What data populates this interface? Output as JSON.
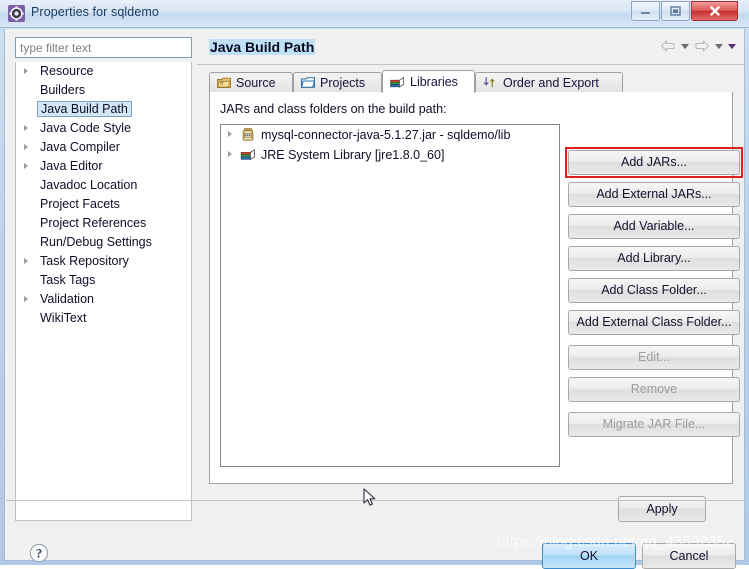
{
  "window": {
    "title": "Properties for sqldemo",
    "icon": "gear-icon",
    "controls": {
      "minimize": "—",
      "maximize": "□",
      "close": "✕"
    }
  },
  "sidebar": {
    "filter": {
      "value": "",
      "placeholder": "type filter text"
    },
    "items": [
      {
        "label": "Resource",
        "expandable": true,
        "selected": false
      },
      {
        "label": "Builders",
        "expandable": false,
        "selected": false
      },
      {
        "label": "Java Build Path",
        "expandable": false,
        "selected": true
      },
      {
        "label": "Java Code Style",
        "expandable": true,
        "selected": false
      },
      {
        "label": "Java Compiler",
        "expandable": true,
        "selected": false
      },
      {
        "label": "Java Editor",
        "expandable": true,
        "selected": false
      },
      {
        "label": "Javadoc Location",
        "expandable": false,
        "selected": false
      },
      {
        "label": "Project Facets",
        "expandable": false,
        "selected": false
      },
      {
        "label": "Project References",
        "expandable": false,
        "selected": false
      },
      {
        "label": "Run/Debug Settings",
        "expandable": false,
        "selected": false
      },
      {
        "label": "Task Repository",
        "expandable": true,
        "selected": false
      },
      {
        "label": "Task Tags",
        "expandable": false,
        "selected": false
      },
      {
        "label": "Validation",
        "expandable": true,
        "selected": false
      },
      {
        "label": "WikiText",
        "expandable": false,
        "selected": false
      }
    ]
  },
  "page": {
    "title": "Java Build Path",
    "nav": {
      "back_icon": "arrow-left-icon",
      "back_menu_icon": "chevron-down-icon",
      "forward_icon": "arrow-right-icon",
      "forward_menu_icon": "chevron-down-icon",
      "view_menu_icon": "chevron-down-icon"
    }
  },
  "tabs": [
    {
      "label": "Source",
      "icon": "source-folder-icon",
      "active": false
    },
    {
      "label": "Projects",
      "icon": "open-folder-icon",
      "active": false
    },
    {
      "label": "Libraries",
      "icon": "library-books-icon",
      "active": true
    },
    {
      "label": "Order and Export",
      "icon": "order-export-icon",
      "active": false
    }
  ],
  "libraries_tab": {
    "description": "JARs and class folders on the build path:",
    "entries": [
      {
        "label": "mysql-connector-java-5.1.27.jar - sqldemo/lib",
        "icon": "jar-icon",
        "expandable": true
      },
      {
        "label": "JRE System Library [jre1.8.0_60]",
        "icon": "library-icon",
        "expandable": true
      }
    ],
    "buttons": [
      {
        "label": "Add JARs...",
        "enabled": true,
        "highlighted": true,
        "gap": false
      },
      {
        "label": "Add External JARs...",
        "enabled": true,
        "highlighted": false,
        "gap": false
      },
      {
        "label": "Add Variable...",
        "enabled": true,
        "highlighted": false,
        "gap": false
      },
      {
        "label": "Add Library...",
        "enabled": true,
        "highlighted": false,
        "gap": false
      },
      {
        "label": "Add Class Folder...",
        "enabled": true,
        "highlighted": false,
        "gap": false
      },
      {
        "label": "Add External Class Folder...",
        "enabled": true,
        "highlighted": false,
        "gap": false
      },
      {
        "label": "Edit...",
        "enabled": false,
        "highlighted": false,
        "gap": true
      },
      {
        "label": "Remove",
        "enabled": false,
        "highlighted": false,
        "gap": false
      },
      {
        "label": "Migrate JAR File...",
        "enabled": false,
        "highlighted": false,
        "gap": true
      }
    ]
  },
  "footer": {
    "apply_label": "Apply",
    "help_icon": "help-question-icon",
    "ok_label": "OK",
    "cancel_label": "Cancel"
  },
  "watermark": "https://blog.csdn.net/qq_43592352",
  "colors": {
    "highlight_red": "#e02020",
    "selection_blue": "#d4e7f7",
    "title_highlight": "#bfe0f5",
    "ok_button_blue": "#9fd2f2"
  }
}
